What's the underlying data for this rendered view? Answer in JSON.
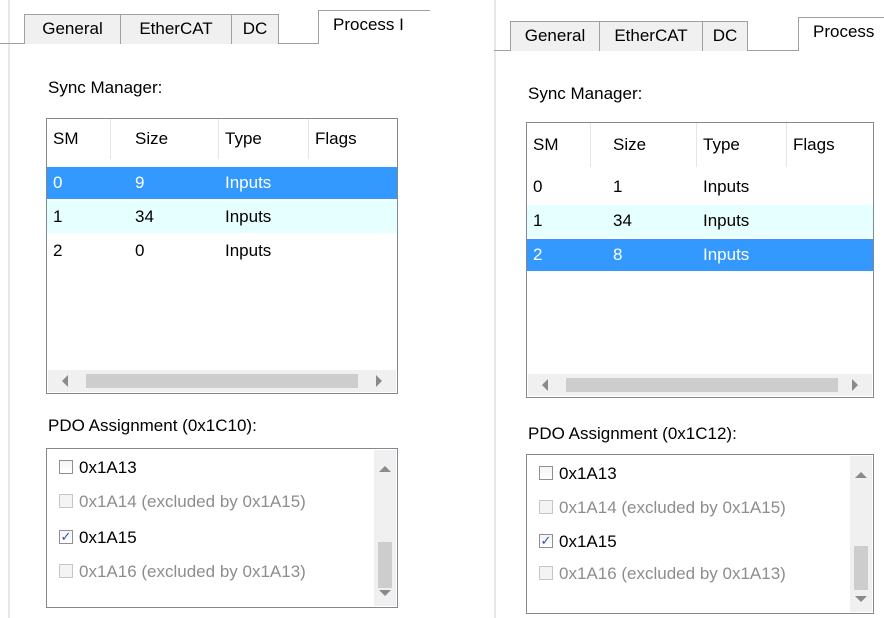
{
  "left": {
    "tabs": [
      {
        "label": "General"
      },
      {
        "label": "EtherCAT"
      },
      {
        "label": "DC"
      },
      {
        "label": "Process I"
      }
    ],
    "sync_manager_label": "Sync Manager:",
    "columns": [
      "SM",
      "Size",
      "Type",
      "Flags"
    ],
    "rows": [
      {
        "sm": "0",
        "size": "9",
        "type": "Inputs",
        "flags": ""
      },
      {
        "sm": "1",
        "size": "34",
        "type": "Inputs",
        "flags": ""
      },
      {
        "sm": "2",
        "size": "0",
        "type": "Inputs",
        "flags": ""
      }
    ],
    "selected_row": 0,
    "pdo_label": "PDO Assignment (0x1C10):",
    "pdo_items": [
      {
        "label": "0x1A13",
        "checked": false,
        "enabled": true
      },
      {
        "label": "0x1A14 (excluded by 0x1A15)",
        "checked": false,
        "enabled": false
      },
      {
        "label": "0x1A15",
        "checked": true,
        "enabled": true
      },
      {
        "label": "0x1A16 (excluded by 0x1A13)",
        "checked": false,
        "enabled": false
      }
    ]
  },
  "right": {
    "tabs": [
      {
        "label": "General"
      },
      {
        "label": "EtherCAT"
      },
      {
        "label": "DC"
      },
      {
        "label": "Process"
      }
    ],
    "sync_manager_label": "Sync Manager:",
    "columns": [
      "SM",
      "Size",
      "Type",
      "Flags"
    ],
    "rows": [
      {
        "sm": "0",
        "size": "1",
        "type": "Inputs",
        "flags": ""
      },
      {
        "sm": "1",
        "size": "34",
        "type": "Inputs",
        "flags": ""
      },
      {
        "sm": "2",
        "size": "8",
        "type": "Inputs",
        "flags": ""
      }
    ],
    "selected_row": 2,
    "pdo_label": "PDO Assignment (0x1C12):",
    "pdo_items": [
      {
        "label": "0x1A13",
        "checked": false,
        "enabled": true
      },
      {
        "label": "0x1A14 (excluded by 0x1A15)",
        "checked": false,
        "enabled": false
      },
      {
        "label": "0x1A15",
        "checked": true,
        "enabled": true
      },
      {
        "label": "0x1A16 (excluded by 0x1A13)",
        "checked": false,
        "enabled": false
      }
    ]
  },
  "colors": {
    "selection": "#3399ff",
    "alt_row": "#e6ffff",
    "tab_bg": "#f0f0f0",
    "border": "#a0a0a0",
    "disabled_text": "#8d8d8d"
  }
}
